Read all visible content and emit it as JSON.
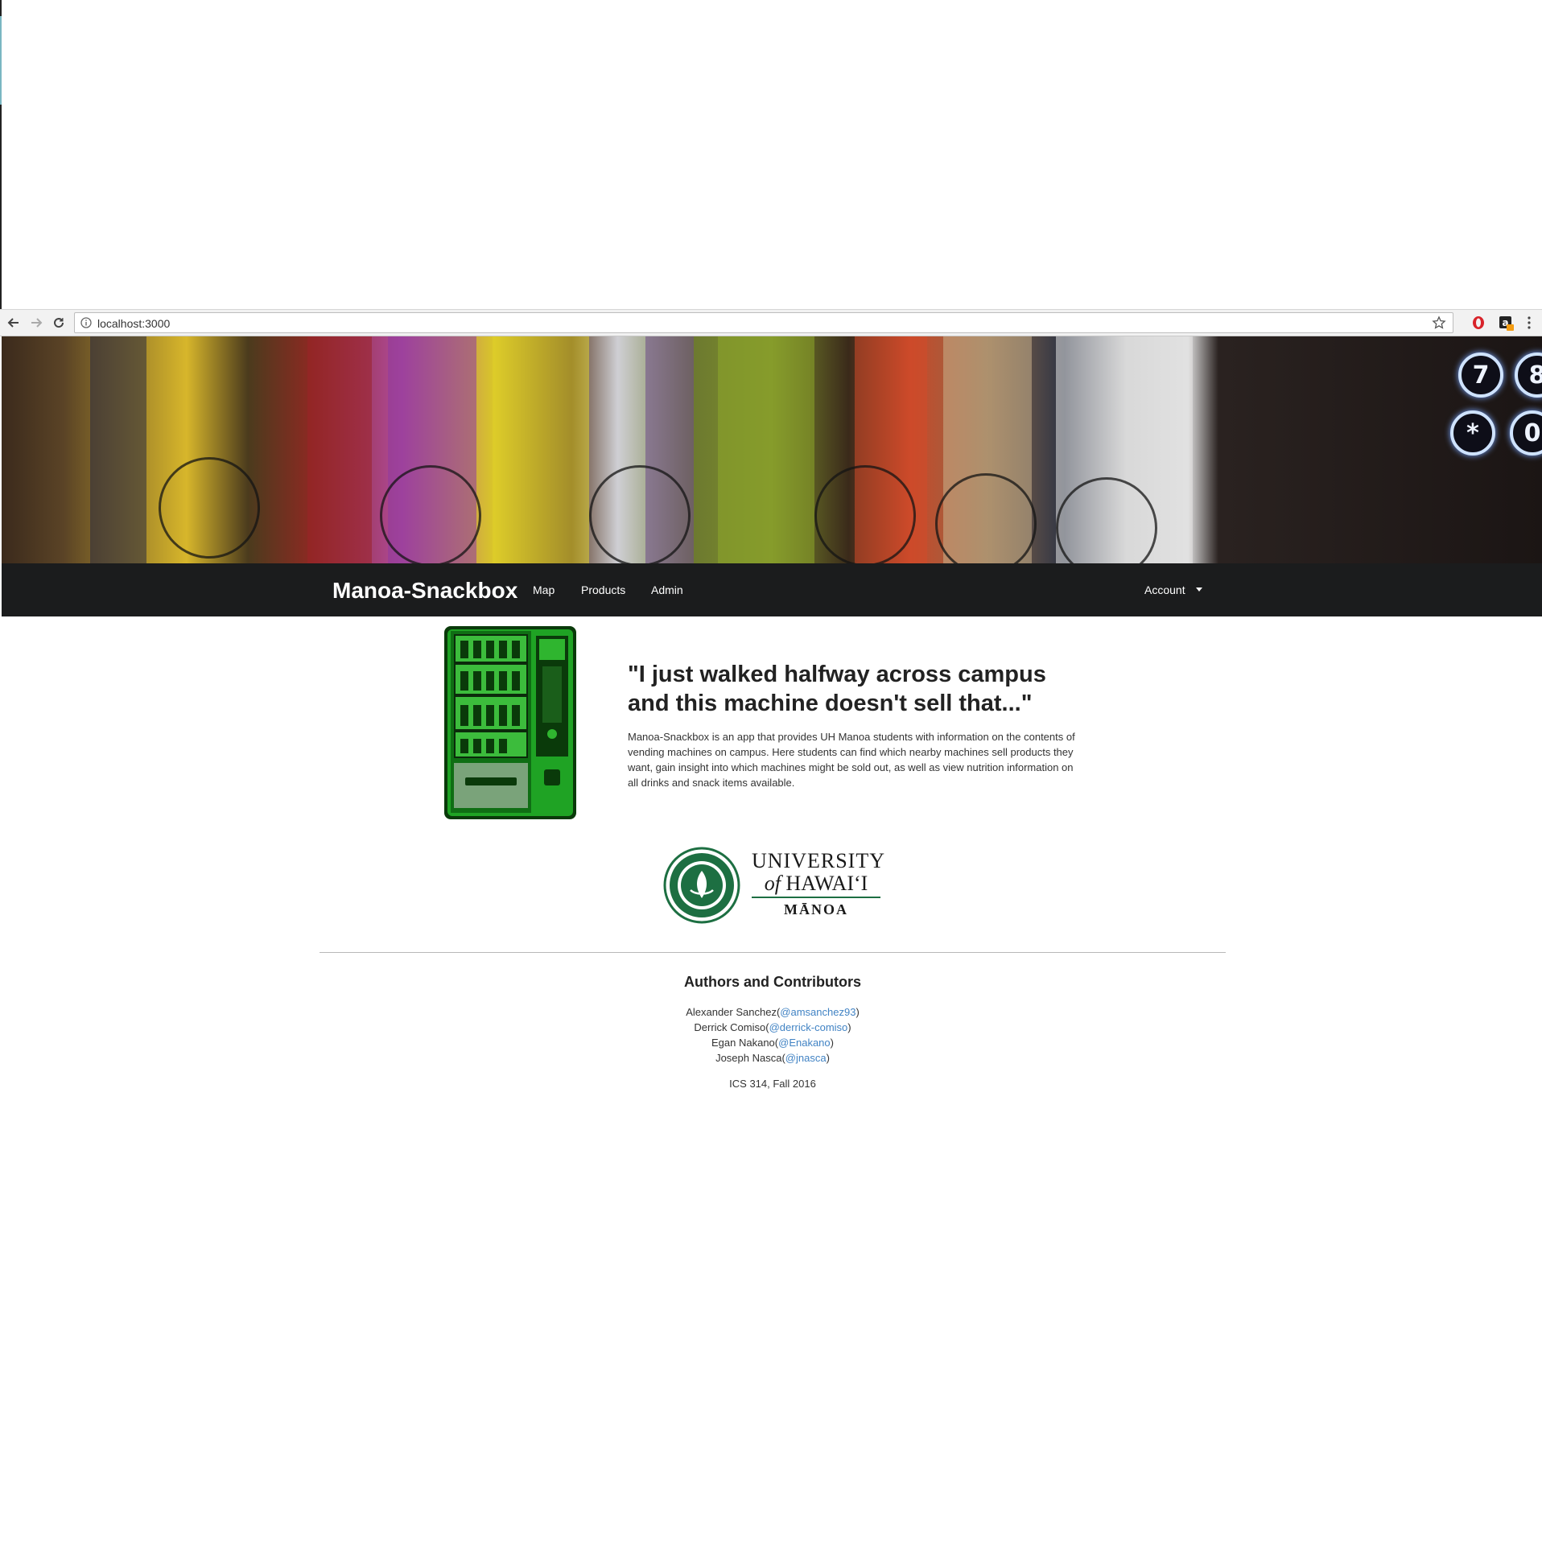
{
  "browser": {
    "url": "localhost:3000",
    "icons": [
      "back-icon",
      "forward-icon",
      "reload-icon",
      "info-icon",
      "bookmark-star-icon",
      "opera-extension-icon",
      "amazon-extension-icon",
      "menu-kebab-icon"
    ]
  },
  "hero": {
    "keypad_keys": [
      "7",
      "8",
      "*",
      "0"
    ]
  },
  "navbar": {
    "brand": "Manoa-Snackbox",
    "links": [
      "Map",
      "Products",
      "Admin"
    ],
    "account": "Account"
  },
  "intro": {
    "quote": "\"I just walked halfway across campus and this machine doesn't sell that...\"",
    "description": "Manoa-Snackbox is an app that provides UH Manoa students with information on the contents of vending machines on campus. Here students can find which nearby machines sell products they want, gain insight into which machines might be sold out, as well as view nutrition information on all drinks and snack items available."
  },
  "university": {
    "line1": "UNIVERSITY",
    "line2_of": "of",
    "line2_name": "HAWAI‘I",
    "line3": "MĀNOA"
  },
  "authors": {
    "title": "Authors and Contributors",
    "list": [
      {
        "name": "Alexander Sanchez",
        "handle": "@amsanchez93"
      },
      {
        "name": "Derrick Comiso",
        "handle": "@derrick-comiso"
      },
      {
        "name": "Egan Nakano",
        "handle": "@Enakano"
      },
      {
        "name": "Joseph Nasca",
        "handle": "@jnasca"
      }
    ],
    "course": "ICS 314, Fall 2016"
  },
  "colors": {
    "navbar_bg": "#1b1c1d",
    "link": "#4183c4",
    "vending_green": "#1fa324",
    "uh_green": "#1d6f42"
  }
}
